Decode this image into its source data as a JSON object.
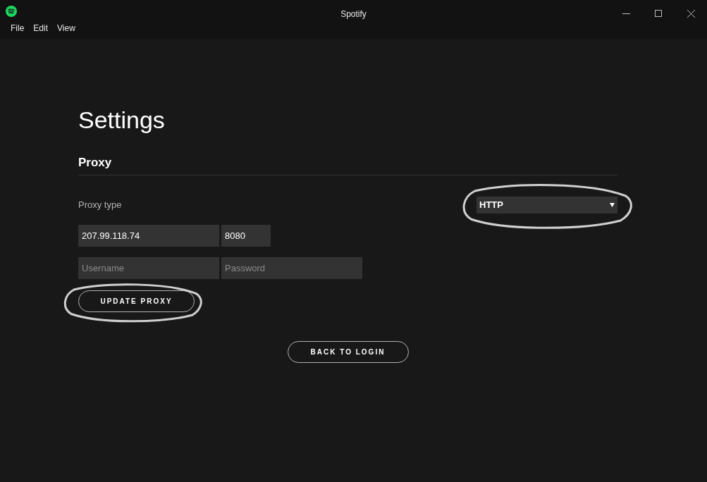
{
  "window": {
    "title": "Spotify"
  },
  "menu": [
    "File",
    "Edit",
    "View"
  ],
  "page": {
    "title": "Settings"
  },
  "proxy": {
    "heading": "Proxy",
    "type_label": "Proxy type",
    "type_value": "HTTP",
    "host": {
      "value": "207.99.118.74"
    },
    "port": {
      "value": "8080"
    },
    "username": {
      "placeholder": "Username"
    },
    "password": {
      "placeholder": "Password"
    },
    "update_button": "UPDATE PROXY"
  },
  "back_button": "BACK TO LOGIN"
}
